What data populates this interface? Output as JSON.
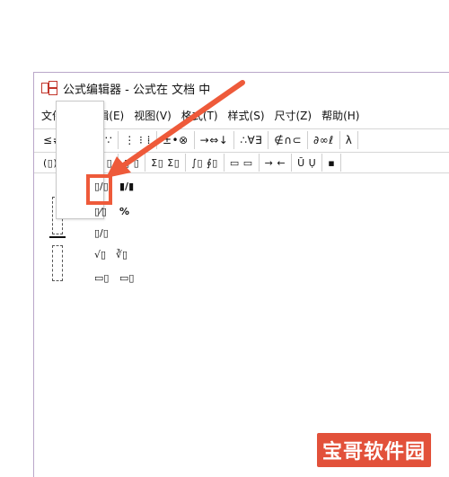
{
  "window": {
    "title": "公式编辑器 - 公式在 文档 中"
  },
  "menu": [
    "文件(F)",
    "编辑(E)",
    "视图(V)",
    "格式(T)",
    "样式(S)",
    "尺寸(Z)",
    "帮助(H)"
  ],
  "toolbar1": [
    "≤≠≈",
    "ἀab∵",
    "⋮ ⁝ ⁞",
    "±•⊗",
    "→⇔↓",
    "∴∀∃",
    "∉∩⊂",
    "∂∞ℓ",
    "λ"
  ],
  "toolbar2": [
    "(▯) [▯]",
    "▯/▯ ▯",
    "▯ ▯",
    "Σ▯ Σ▯",
    "∫▯ ∮▯",
    "▭ ▭",
    "→ ←",
    "Ū Ụ",
    "▪"
  ],
  "dropdown": {
    "row1": [
      "▯/▯",
      "▮/▮"
    ],
    "row2": [
      "▯⁄▯",
      "%"
    ],
    "row3": [
      "▯/▯"
    ],
    "row4": [
      "√▯",
      "∛▯"
    ],
    "row5": [
      "▭▯",
      "▭▯"
    ]
  },
  "watermark": "宝哥软件园",
  "colors": {
    "highlight": "#ee5a3a",
    "window_border": "#b9a7c9",
    "watermark_bg": "#e2513a"
  }
}
